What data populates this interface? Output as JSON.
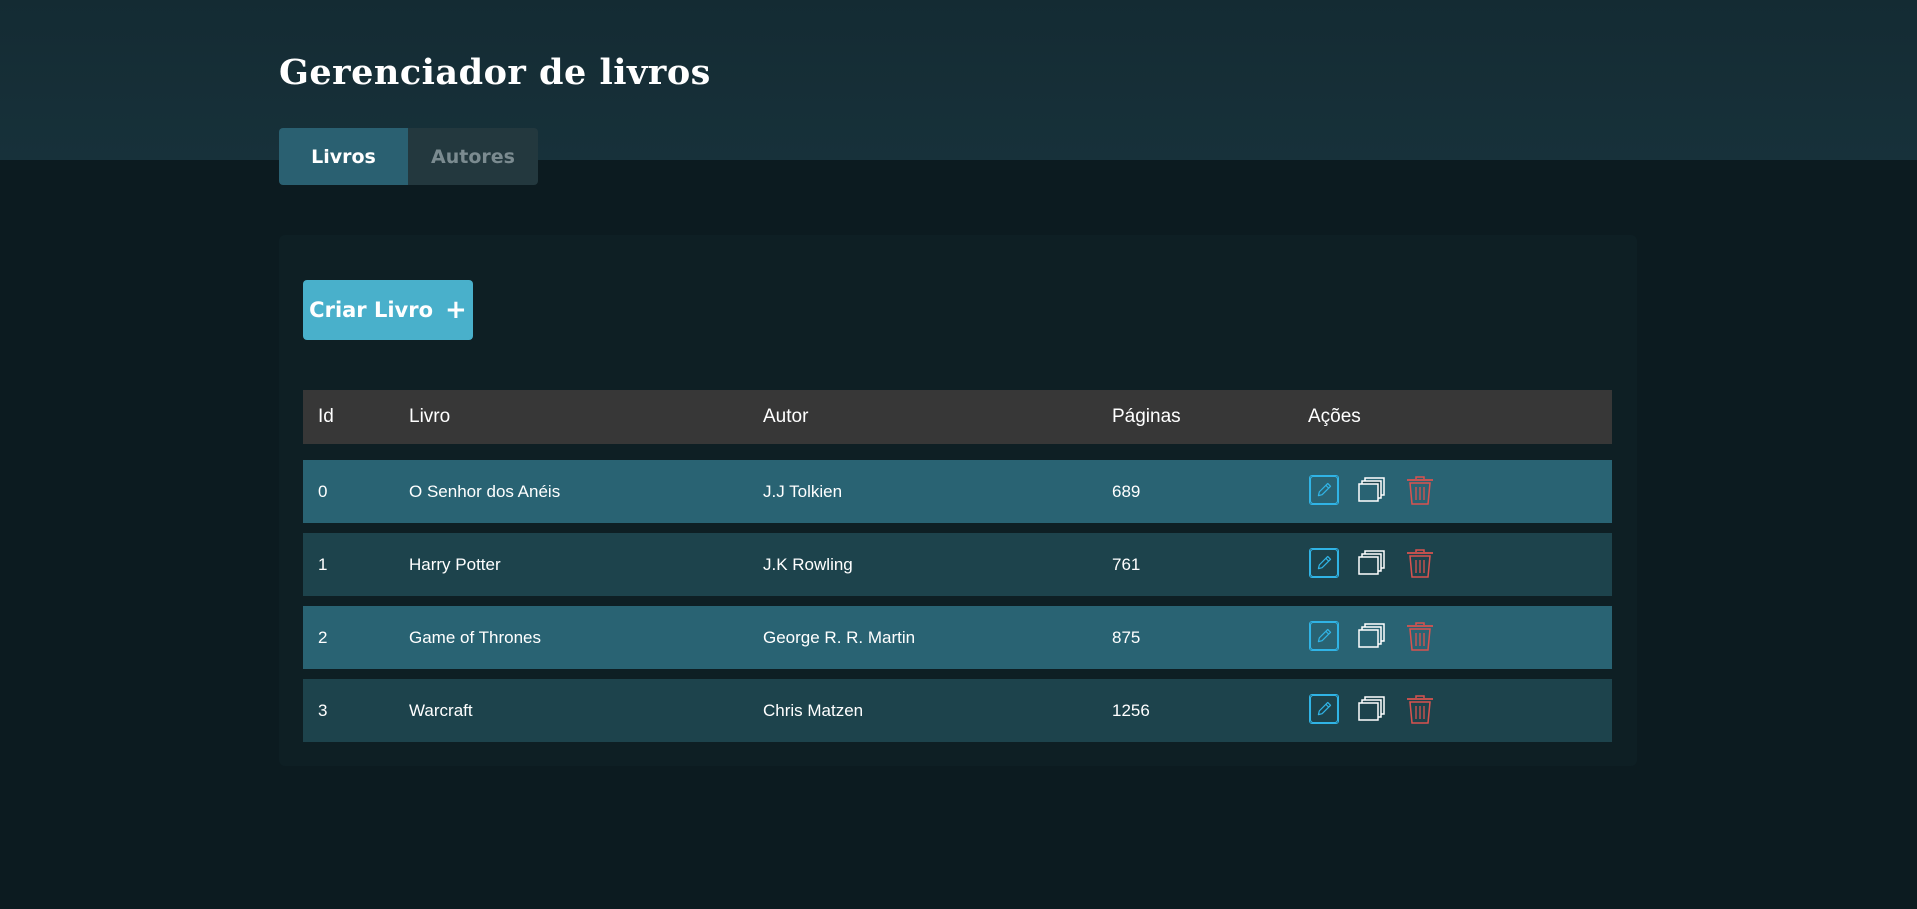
{
  "header": {
    "title": "Gerenciador de livros"
  },
  "tabs": [
    {
      "label": "Livros",
      "active": true
    },
    {
      "label": "Autores",
      "active": false
    }
  ],
  "main": {
    "create_button_label": "Criar Livro",
    "create_button_icon": "plus-icon",
    "table": {
      "columns": [
        "Id",
        "Livro",
        "Autor",
        "Páginas",
        "Ações"
      ],
      "rows": [
        {
          "id": "0",
          "livro": "O Senhor dos Anéis",
          "autor": "J.J Tolkien",
          "paginas": "689"
        },
        {
          "id": "1",
          "livro": "Harry Potter",
          "autor": "J.K Rowling",
          "paginas": "761"
        },
        {
          "id": "2",
          "livro": "Game of Thrones",
          "autor": "George R. R. Martin",
          "paginas": "875"
        },
        {
          "id": "3",
          "livro": "Warcraft",
          "autor": "Chris Matzen",
          "paginas": "1256"
        }
      ],
      "row_actions": [
        "edit-icon",
        "copy-icon",
        "trash-icon"
      ]
    }
  },
  "colors": {
    "accent": "#49b0cb",
    "row_a": "#296373",
    "row_b": "#1d434c",
    "header_bg": "#373737",
    "delete": "#d9534f",
    "edit": "#30b4e6"
  }
}
